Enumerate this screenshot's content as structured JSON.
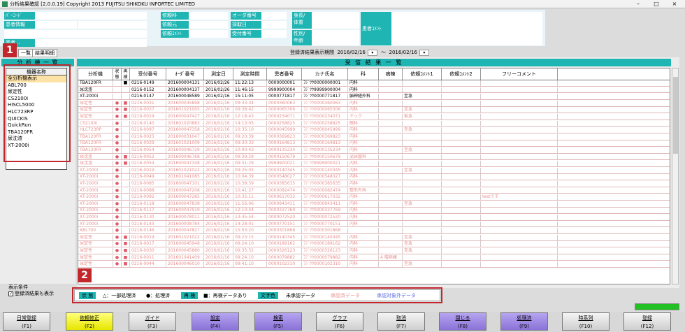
{
  "window": {
    "title": "分析結果確認 [2.0.0.19] Copyright 2013 FUJITSU SHIKOKU INFORTEC LIMITED",
    "minimize": "–",
    "maximize": "□",
    "close": "×"
  },
  "header": {
    "barcode_label": "ﾊﾞｰｺｰﾄﾞ",
    "barcode_value": "",
    "patient_info_label": "患者情報",
    "patient_info_value": "",
    "dept_label": "依頼科",
    "ward_label": "依頼元",
    "ordercomment_label": "依頼ｺﾒﾝﾄ",
    "order_no_label": "オーダ番号",
    "collect_date_label": "採取日",
    "receipt_no_label": "受付番号",
    "height_weight_label": "身長/\n体重",
    "sex_age_label": "性別/\n年齢",
    "patient_comment_label": "患者ｺﾒﾝﾄ",
    "misc_label": "患者..."
  },
  "tabs": [
    {
      "label": "一覧"
    },
    {
      "label": "結果明細"
    }
  ],
  "period": {
    "label": "登録済結果表示期間",
    "from": "2016/02/16",
    "sep": "～",
    "to": "2016/02/16",
    "dropdown_glyph": "▾"
  },
  "analyzer_panel": {
    "title": "分 析 機 一 覧",
    "list_header": "機器名称",
    "items": [
      "全分析機表示",
      "ABL700",
      "尿定性",
      "CS2100i",
      "HISCL5000",
      "HLC723RP",
      "QUICKIS",
      "QuickRun",
      "TBA120FR",
      "尿沈渣",
      "XT-2000i"
    ],
    "selected_index": 0
  },
  "display_conditions": {
    "label": "表示条件",
    "checkbox_label": "登録済結果も表示",
    "checked": true,
    "check_glyph": "✓"
  },
  "results": {
    "title": "受 信 結 果 一 覧",
    "columns": [
      "分析機",
      "状態",
      "再検",
      "受付番号",
      "ｵｰﾀﾞ番号",
      "測定日",
      "測定時間",
      "患者番号",
      "カナ氏名",
      "科",
      "病棟",
      "依頼ｺﾒﾝﾄ1",
      "依頼ｺﾒﾝﾄ2",
      "フリーコメント"
    ],
    "rows": [
      {
        "analyzer": "TBA120FR",
        "state": "",
        "retest": "■",
        "receipt": "0216-0149",
        "order": "201600004131",
        "date": "2016/02/26",
        "time": "11:22:13",
        "patient": "0000000001",
        "kana": "ﾌｼﾞﾂｳ0000000001",
        "dept": "内科",
        "ward": "",
        "c1": "",
        "c2": "",
        "free": "",
        "style": "black"
      },
      {
        "analyzer": "尿沈渣",
        "state": "",
        "retest": "",
        "receipt": "0216-0152",
        "order": "201600004137",
        "date": "2016/02/26",
        "time": "11:46:15",
        "patient": "9999900004",
        "kana": "ﾌｼﾞﾂｳ9999900004",
        "dept": "内科",
        "ward": "",
        "c1": "",
        "c2": "",
        "free": "",
        "style": "black"
      },
      {
        "analyzer": "XT-2000i",
        "state": "",
        "retest": "",
        "receipt": "0216-0147",
        "order": "201600048589",
        "date": "2016/02/16",
        "time": "15:11:05",
        "patient": "0000771817",
        "kana": "ﾌｼﾞﾂｳ0000771817",
        "dept": "脳神経外科",
        "ward": "",
        "c1": "至急",
        "c2": "",
        "free": "",
        "style": "black"
      },
      {
        "analyzer": "尿定性",
        "state": "●",
        "retest": "■",
        "receipt": "0216-0031",
        "order": "201600045898",
        "date": "2016/02/16",
        "time": "09:33:34",
        "patient": "0000360063",
        "kana": "ﾌｼﾞﾂｳ0000360063",
        "dept": "内科",
        "ward": "",
        "c1": "",
        "c2": "",
        "free": "",
        "style": "pink"
      },
      {
        "analyzer": "尿定性",
        "state": "●",
        "retest": "■",
        "receipt": "0216-0037",
        "order": "201601021005",
        "date": "2016/02/16",
        "time": "09:38:42",
        "patient": "0000065306",
        "kana": "ﾌｼﾞﾂｳ0000065306",
        "dept": "内科",
        "ward": "",
        "c1": "至急",
        "c2": "",
        "free": "",
        "style": "pink"
      },
      {
        "analyzer": "尿定性",
        "state": "●",
        "retest": "■",
        "receipt": "0216-0019",
        "order": "201600047427",
        "date": "2016/02/16",
        "time": "12:18:43",
        "patient": "0000234071",
        "kana": "ﾌｼﾞﾂｳ0000234071",
        "dept": "ドック",
        "ward": "",
        "c1": "緊急",
        "c2": "",
        "free": "",
        "style": "pink"
      },
      {
        "analyzer": "CS2100i",
        "state": "●",
        "retest": "",
        "receipt": "0216-0140",
        "order": "201601020883",
        "date": "2016/02/16",
        "time": "14:13:05",
        "patient": "0000258825",
        "kana": "ﾌｼﾞﾂｳ0000258825",
        "dept": "眼科",
        "ward": "",
        "c1": "",
        "c2": "",
        "free": "",
        "style": "pink"
      },
      {
        "analyzer": "HLC723RP",
        "state": "●",
        "retest": "",
        "receipt": "0216-0097",
        "order": "201600047358",
        "date": "2016/02/16",
        "time": "10:35:10",
        "patient": "0000045999",
        "kana": "ﾌｼﾞﾂｳ0000045999",
        "dept": "内科",
        "ward": "",
        "c1": "至急",
        "c2": "",
        "free": "",
        "style": "pink"
      },
      {
        "analyzer": "TBA120FR",
        "state": "●",
        "retest": "",
        "receipt": "0216-0025",
        "order": "201600031047",
        "date": "2016/02/16",
        "time": "09:20:39",
        "patient": "0000369823",
        "kana": "ﾌｼﾞﾂｳ0000369823",
        "dept": "内科",
        "ward": "",
        "c1": "",
        "c2": "",
        "free": "",
        "style": "pink"
      },
      {
        "analyzer": "TBA120FR",
        "state": "●",
        "retest": "",
        "receipt": "0216-0029",
        "order": "201601021009",
        "date": "2016/02/16",
        "time": "09:30:33",
        "patient": "0000164813",
        "kana": "ﾌｼﾞﾂｳ0000164813",
        "dept": "内科",
        "ward": "",
        "c1": "",
        "c2": "",
        "free": "",
        "style": "pink"
      },
      {
        "analyzer": "TBA120FR",
        "state": "●",
        "retest": "",
        "receipt": "0216-0054",
        "order": "201600046729",
        "date": "2016/02/16",
        "time": "10:00:43",
        "patient": "0000135234",
        "kana": "ﾌｼﾞﾂｳ0000135234",
        "dept": "内科",
        "ward": "",
        "c1": "至急",
        "c2": "",
        "free": "",
        "style": "pink"
      },
      {
        "analyzer": "尿沈渣",
        "state": "●",
        "retest": "■",
        "receipt": "0216-0052",
        "order": "201600046768",
        "date": "2016/02/16",
        "time": "09:39:29",
        "patient": "0000150679",
        "kana": "ﾌｼﾞﾂｳ0000150679",
        "dept": "泌尿器科",
        "ward": "",
        "c1": "",
        "c2": "",
        "free": "",
        "style": "pink"
      },
      {
        "analyzer": "尿沈渣",
        "state": "●",
        "retest": "■",
        "receipt": "0216-0054",
        "order": "201600047348",
        "date": "2016/02/16",
        "time": "09:31:29",
        "patient": "9999900021",
        "kana": "ﾌｼﾞﾂｳ9999900021",
        "dept": "内科",
        "ward": "",
        "c1": "",
        "c2": "",
        "free": "",
        "style": "pink"
      },
      {
        "analyzer": "XT-2000i",
        "state": "●",
        "retest": "",
        "receipt": "0216-0019",
        "order": "201601021022",
        "date": "2016/02/16",
        "time": "09:25:03",
        "patient": "0000140345",
        "kana": "ﾌｼﾞﾂｳ0000140345",
        "dept": "内科",
        "ward": "",
        "c1": "至急",
        "c2": "",
        "free": "",
        "style": "pink"
      },
      {
        "analyzer": "XT-2000i",
        "state": "●",
        "retest": "",
        "receipt": "0216-0049",
        "order": "201601041085",
        "date": "2016/02/16",
        "time": "10:04:39",
        "patient": "0000548027",
        "kana": "ﾌｼﾞﾂｳ0000548027",
        "dept": "内科",
        "ward": "",
        "c1": "",
        "c2": "",
        "free": "",
        "style": "pink"
      },
      {
        "analyzer": "XT-2000i",
        "state": "●",
        "retest": "",
        "receipt": "0216-0085",
        "order": "201600047101",
        "date": "2016/02/16",
        "time": "10:38:59",
        "patient": "0000385635",
        "kana": "ﾌｼﾞﾂｳ0000385635",
        "dept": "内科",
        "ward": "",
        "c1": "",
        "c2": "",
        "free": "",
        "style": "pink"
      },
      {
        "analyzer": "XT-2000i",
        "state": "●",
        "retest": "",
        "receipt": "0216-0088",
        "order": "201600047208",
        "date": "2016/02/16",
        "time": "10:41:27",
        "patient": "0000082474",
        "kana": "ﾌｼﾞﾂｳ0000082474",
        "dept": "整形外科",
        "ward": "",
        "c1": "",
        "c2": "",
        "free": "",
        "style": "pink"
      },
      {
        "analyzer": "XT-2000i",
        "state": "●",
        "retest": "",
        "receipt": "0216-0092",
        "order": "201600047285",
        "date": "2016/02/16",
        "time": "10:35:11",
        "patient": "0000617032",
        "kana": "ﾌｼﾞﾂｳ0000617032",
        "dept": "内科",
        "ward": "",
        "c1": "",
        "c2": "",
        "free": "testです",
        "style": "pink"
      },
      {
        "analyzer": "XT-2000i",
        "state": "●",
        "retest": "",
        "receipt": "0216-0118",
        "order": "201600047838",
        "date": "2016/02/16",
        "time": "11:56:06",
        "patient": "0000943411",
        "kana": "ﾌｼﾞﾂｳ0000943411",
        "dept": "内科",
        "ward": "",
        "c1": "至急",
        "c2": "",
        "free": "",
        "style": "pink"
      },
      {
        "analyzer": "XT-2000i",
        "state": "●",
        "retest": "",
        "receipt": "0216-0117",
        "order": "201600047919",
        "date": "2016/02/16",
        "time": "12:10:44",
        "patient": "0000337769",
        "kana": "ﾌｼﾞﾂｳ0000337769",
        "dept": "内科",
        "ward": "",
        "c1": "",
        "c2": "",
        "free": "",
        "style": "pink"
      },
      {
        "analyzer": "XT-2000i",
        "state": "●",
        "retest": "",
        "receipt": "0216-0130",
        "order": "201600078011",
        "date": "2016/02/16",
        "time": "13:45:54",
        "patient": "0000072520",
        "kana": "ﾌｼﾞﾂｳ0000072520",
        "dept": "内科",
        "ward": "",
        "c1": "",
        "c2": "",
        "free": "",
        "style": "pink"
      },
      {
        "analyzer": "XT-2000i",
        "state": "●",
        "retest": "",
        "receipt": "0216-0143",
        "order": "201600008784",
        "date": "2016/02/16",
        "time": "14:28:01",
        "patient": "0000770151",
        "kana": "ﾌｼﾞﾂｳ0000770151",
        "dept": "内科",
        "ward": "",
        "c1": "",
        "c2": "",
        "free": "",
        "style": "pink"
      },
      {
        "analyzer": "ABL700",
        "state": "●",
        "retest": "",
        "receipt": "0216-0146",
        "order": "201600047827",
        "date": "2016/02/16",
        "time": "15:03:20",
        "patient": "0000301868",
        "kana": "ﾌｼﾞﾂｳ0000301868",
        "dept": "",
        "ward": "",
        "c1": "",
        "c2": "",
        "free": "",
        "style": "pink"
      },
      {
        "analyzer": "尿定性",
        "state": "●",
        "retest": "■",
        "receipt": "0216-0019",
        "order": "201601021022",
        "date": "2016/02/16",
        "time": "09:23:15",
        "patient": "0000140345",
        "kana": "ﾌｼﾞﾂｳ0000140345",
        "dept": "内科",
        "ward": "",
        "c1": "至急",
        "c2": "",
        "free": "",
        "style": "pink"
      },
      {
        "analyzer": "尿定性",
        "state": "●",
        "retest": "■",
        "receipt": "0216-0017",
        "order": "201600045948",
        "date": "2016/02/16",
        "time": "09:24:10",
        "patient": "0000189162",
        "kana": "ﾌｼﾞﾂｳ0000189162",
        "dept": "内科",
        "ward": "",
        "c1": "至急",
        "c2": "",
        "free": "",
        "style": "pink"
      },
      {
        "analyzer": "尿定性",
        "state": "●",
        "retest": "■",
        "receipt": "0216-0030",
        "order": "201600045880",
        "date": "2016/02/16",
        "time": "09:35:52",
        "patient": "0000326123",
        "kana": "ﾌｼﾞﾂｳ0000326123",
        "dept": "内科",
        "ward": "",
        "c1": "至急",
        "c2": "",
        "free": "",
        "style": "pink"
      },
      {
        "analyzer": "尿定性",
        "state": "●",
        "retest": "■",
        "receipt": "0216-0011",
        "order": "201601041409",
        "date": "2016/02/16",
        "time": "09:24:10",
        "patient": "0000079882",
        "kana": "ﾌｼﾞﾂｳ0000079882",
        "dept": "内科",
        "ward": "4 階病棟",
        "c1": "",
        "c2": "",
        "free": "",
        "style": "pink"
      },
      {
        "analyzer": "尿定性",
        "state": "●",
        "retest": "■",
        "receipt": "0216-0044",
        "order": "201600046010",
        "date": "2016/02/16",
        "time": "09:41:10",
        "patient": "0000102310",
        "kana": "ﾌｼﾞﾂｳ0000102310",
        "dept": "内科",
        "ward": "",
        "c1": "至急",
        "c2": "",
        "free": "",
        "style": "pink"
      }
    ]
  },
  "legend": {
    "state_label": "状 態",
    "partial_label": "△：一部処理済",
    "done_label": "●：処理済",
    "retest_label": "再 検",
    "retest_value": "■：再検データあり",
    "text_color_label": "文字色",
    "unregistered": "未承認データ",
    "registered": "承認済データ",
    "excluded": "承認対象外データ",
    "colors": {
      "unregistered": "#000000",
      "registered": "#e89090",
      "excluded": "#5a6ae0"
    }
  },
  "progress": {
    "value": 1.0
  },
  "fkeys": [
    {
      "label": "日常登録",
      "key": "(F1)",
      "style": "gray"
    },
    {
      "label": "依頼修正",
      "key": "(F2)",
      "style": "yellow"
    },
    {
      "label": "ガイド",
      "key": "(F3)",
      "style": "gray"
    },
    {
      "label": "設定",
      "key": "(F4)",
      "style": "purple"
    },
    {
      "label": "検索",
      "key": "(F5)",
      "style": "purple"
    },
    {
      "label": "グラフ",
      "key": "(F6)",
      "style": "gray"
    },
    {
      "label": "取消",
      "key": "(F7)",
      "style": "gray"
    },
    {
      "label": "閉じる",
      "key": "(F8)",
      "style": "purple"
    },
    {
      "label": "処理済",
      "key": "(F9)",
      "style": "purple"
    },
    {
      "label": "時系列",
      "key": "(F10)",
      "style": "gray"
    },
    {
      "label": "登録",
      "key": "(F12)",
      "style": "gray"
    }
  ],
  "callouts": [
    "1",
    "2"
  ]
}
